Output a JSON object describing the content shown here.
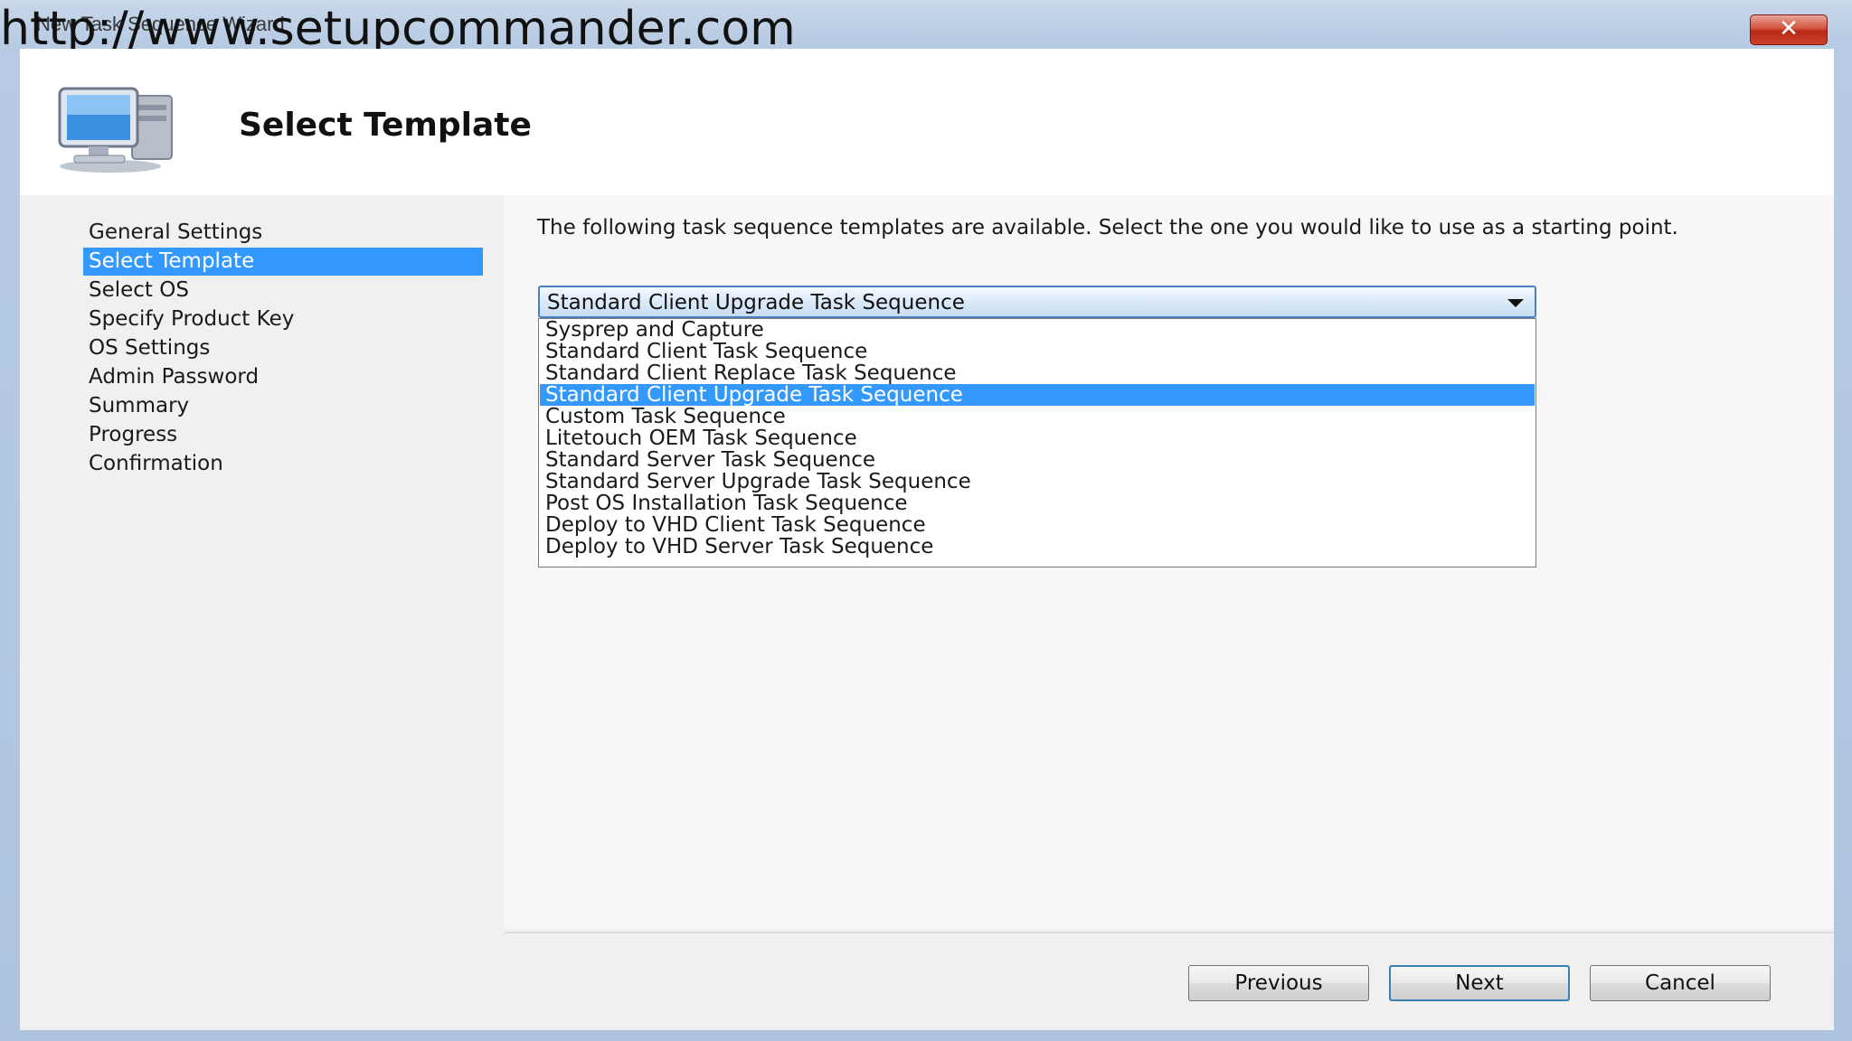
{
  "window": {
    "title": "New Task Sequence Wizard",
    "watermark": "http://www.setupcommander.com",
    "close_symbol": "✕"
  },
  "header": {
    "title": "Select Template",
    "icon": "computer-icon"
  },
  "sidebar": {
    "items": [
      {
        "label": "General Settings",
        "selected": false
      },
      {
        "label": "Select Template",
        "selected": true
      },
      {
        "label": "Select OS",
        "selected": false
      },
      {
        "label": "Specify Product Key",
        "selected": false
      },
      {
        "label": "OS Settings",
        "selected": false
      },
      {
        "label": "Admin Password",
        "selected": false
      },
      {
        "label": "Summary",
        "selected": false
      },
      {
        "label": "Progress",
        "selected": false
      },
      {
        "label": "Confirmation",
        "selected": false
      }
    ]
  },
  "main": {
    "description": "The following task sequence templates are available.  Select the one you would like to use as a starting point.",
    "template_select": {
      "value": "Standard Client Upgrade Task Sequence",
      "options": [
        "Sysprep and Capture",
        "Standard Client Task Sequence",
        "Standard Client Replace Task Sequence",
        "Standard Client Upgrade Task Sequence",
        "Custom Task Sequence",
        "Litetouch OEM Task Sequence",
        "Standard Server Task Sequence",
        "Standard Server Upgrade Task Sequence",
        "Post OS Installation Task Sequence",
        "Deploy to VHD Client Task Sequence",
        "Deploy to VHD Server Task Sequence"
      ],
      "highlighted_index": 3
    }
  },
  "footer": {
    "previous_label": "Previous",
    "next_label": "Next",
    "cancel_label": "Cancel"
  },
  "colors": {
    "selection": "#3399ff",
    "close_button": "#c9402a"
  }
}
